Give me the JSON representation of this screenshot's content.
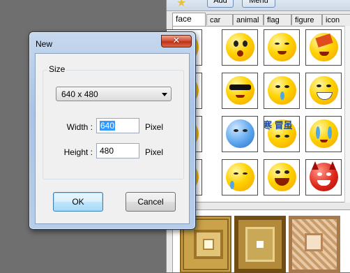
{
  "app": {
    "toolbar": {
      "add_label": "Add",
      "menu_label": "Menu"
    },
    "tabs": [
      {
        "label": "face",
        "active": true
      },
      {
        "label": "car",
        "active": false
      },
      {
        "label": "animal",
        "active": false
      },
      {
        "label": "flag",
        "active": false
      },
      {
        "label": "figure",
        "active": false
      },
      {
        "label": "icon",
        "active": false
      }
    ],
    "grid_text": {
      "kanji": "寒 冒虽"
    }
  },
  "dialog": {
    "title": "New",
    "close_icon": "close-icon",
    "group_label": "Size",
    "size_preset": "640 x 480",
    "width_label": "Width :",
    "width_value": "640",
    "height_label": "Height :",
    "height_value": "480",
    "unit": "Pixel",
    "ok_label": "OK",
    "cancel_label": "Cancel"
  }
}
